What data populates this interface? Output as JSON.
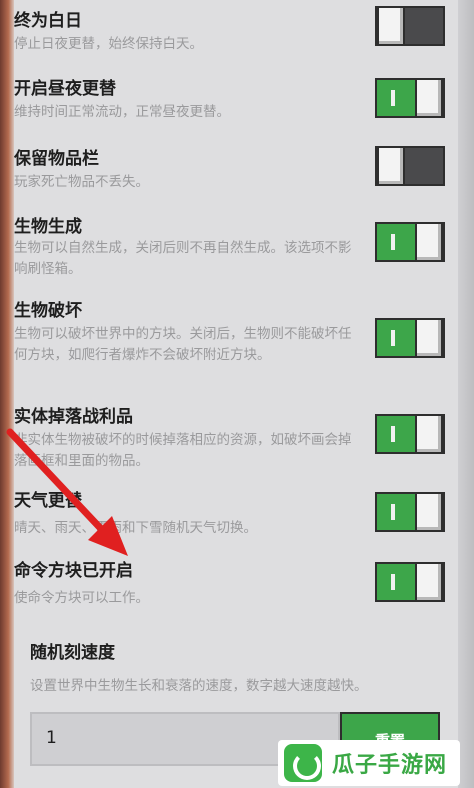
{
  "settings": [
    {
      "title": "终为白日",
      "desc": "停止日夜更替，始终保持白天。",
      "state": "off"
    },
    {
      "title": "开启昼夜更替",
      "desc": "维持时间正常流动，正常昼夜更替。",
      "state": "on"
    },
    {
      "title": "保留物品栏",
      "desc": "玩家死亡物品不丢失。",
      "state": "off"
    },
    {
      "title": "生物生成",
      "desc": "生物可以自然生成，关闭后则不再自然生成。该选项不影响刷怪箱。",
      "state": "on"
    },
    {
      "title": "生物破坏",
      "desc": "生物可以破坏世界中的方块。关闭后，生物则不能破坏任何方块，如爬行者爆炸不会破坏附近方块。",
      "state": "on"
    },
    {
      "title": "实体掉落战利品",
      "desc": "非实体生物被破坏的时候掉落相应的资源，如破坏画会掉落画框和里面的物品。",
      "state": "on"
    },
    {
      "title": "天气更替",
      "desc": "晴天、雨天、雷雨和下雪随机天气切换。",
      "state": "on"
    },
    {
      "title": "命令方块已开启",
      "desc": "使命令方块可以工作。",
      "state": "on"
    }
  ],
  "speed": {
    "title": "随机刻速度",
    "desc": "设置世界中生物生长和衰落的速度，数字越大速度越快。",
    "value": "1",
    "reset_label": "重置"
  },
  "watermark": {
    "text": "瓜子手游网"
  },
  "colors": {
    "toggle_on": "#3da64a",
    "toggle_off": "#4a4a4c",
    "arrow": "#e02020"
  }
}
